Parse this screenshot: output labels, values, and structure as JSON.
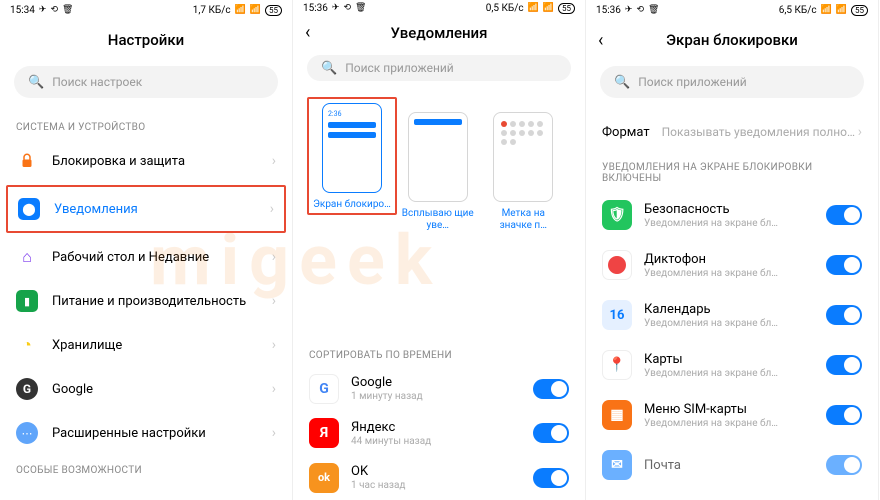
{
  "screens": [
    {
      "status": {
        "time": "15:34",
        "speed": "1,7 КБ/с",
        "battery": "55"
      },
      "title": "Настройки",
      "search": "Поиск настроек",
      "sections": [
        {
          "label": "СИСТЕМА И УСТРОЙСТВО",
          "items": [
            {
              "icon": "lock",
              "bg": "#f97316",
              "text": "Блокировка и защита"
            },
            {
              "icon": "bell",
              "bg": "#0a7cff",
              "text": "Уведомления",
              "highlight": true,
              "blueText": true
            },
            {
              "icon": "home",
              "bg": "#7c3aed",
              "text": "Рабочий стол и Недавние"
            },
            {
              "icon": "battery",
              "bg": "#16a34a",
              "text": "Питание и производительность"
            },
            {
              "icon": "pie",
              "bg": "#facc15",
              "text": "Хранилище"
            },
            {
              "icon": "g",
              "bg": "#fff",
              "text": "Google"
            },
            {
              "icon": "dots",
              "bg": "#60a5fa",
              "text": "Расширенные настройки"
            }
          ]
        },
        {
          "label": "ОСОБЫЕ ВОЗМОЖНОСТИ",
          "items": []
        }
      ]
    },
    {
      "status": {
        "time": "15:36",
        "speed": "0,5 КБ/с",
        "battery": "55"
      },
      "title": "Уведомления",
      "search": "Поиск приложений",
      "tiles": [
        {
          "label": "Экран блокиро…",
          "selected": true,
          "type": "lock"
        },
        {
          "label": "Всплываю щие уве…",
          "type": "popup"
        },
        {
          "label": "Метка на значке п…",
          "type": "dots"
        }
      ],
      "sortLabel": "СОРТИРОВАТЬ ПО ВРЕМЕНИ",
      "apps": [
        {
          "name": "Google",
          "sub": "1 минуту назад",
          "icon": "G",
          "bg": "#fff",
          "fg": "#4285f4",
          "border": true
        },
        {
          "name": "Яндекс",
          "sub": "44 минуты назад",
          "icon": "Я",
          "bg": "#ff0000"
        },
        {
          "name": "OK",
          "sub": "1 час назад",
          "icon": "OK",
          "bg": "#f7931e"
        }
      ]
    },
    {
      "status": {
        "time": "15:36",
        "speed": "6,5 КБ/с",
        "battery": "55"
      },
      "title": "Экран блокировки",
      "search": "Поиск приложений",
      "format": {
        "label": "Формат",
        "value": "Показывать уведомления полностью"
      },
      "sectionLabel": "УВЕДОМЛЕНИЯ НА ЭКРАНЕ БЛОКИРОВКИ ВКЛЮЧЕНЫ",
      "apps": [
        {
          "name": "Безопасность",
          "sub": "Уведомления на экране бл…",
          "icon": "✓",
          "bg": "#22c55e"
        },
        {
          "name": "Диктофон",
          "sub": "Уведомления на экране бл…",
          "icon": "●",
          "bg": "#ef4444"
        },
        {
          "name": "Календарь",
          "sub": "Уведомления на экране бл…",
          "icon": "16",
          "bg": "#e5f0ff",
          "fg": "#0a7cff"
        },
        {
          "name": "Карты",
          "sub": "Уведомления на экране бл…",
          "icon": "📍",
          "bg": "#fff",
          "border": true
        },
        {
          "name": "Меню SIM-карты",
          "sub": "Уведомления на экране бл…",
          "icon": "▦",
          "bg": "#f97316"
        },
        {
          "name": "Почта",
          "sub": "",
          "icon": "✉",
          "bg": "#0a7cff"
        }
      ]
    }
  ],
  "watermark": "migeek"
}
